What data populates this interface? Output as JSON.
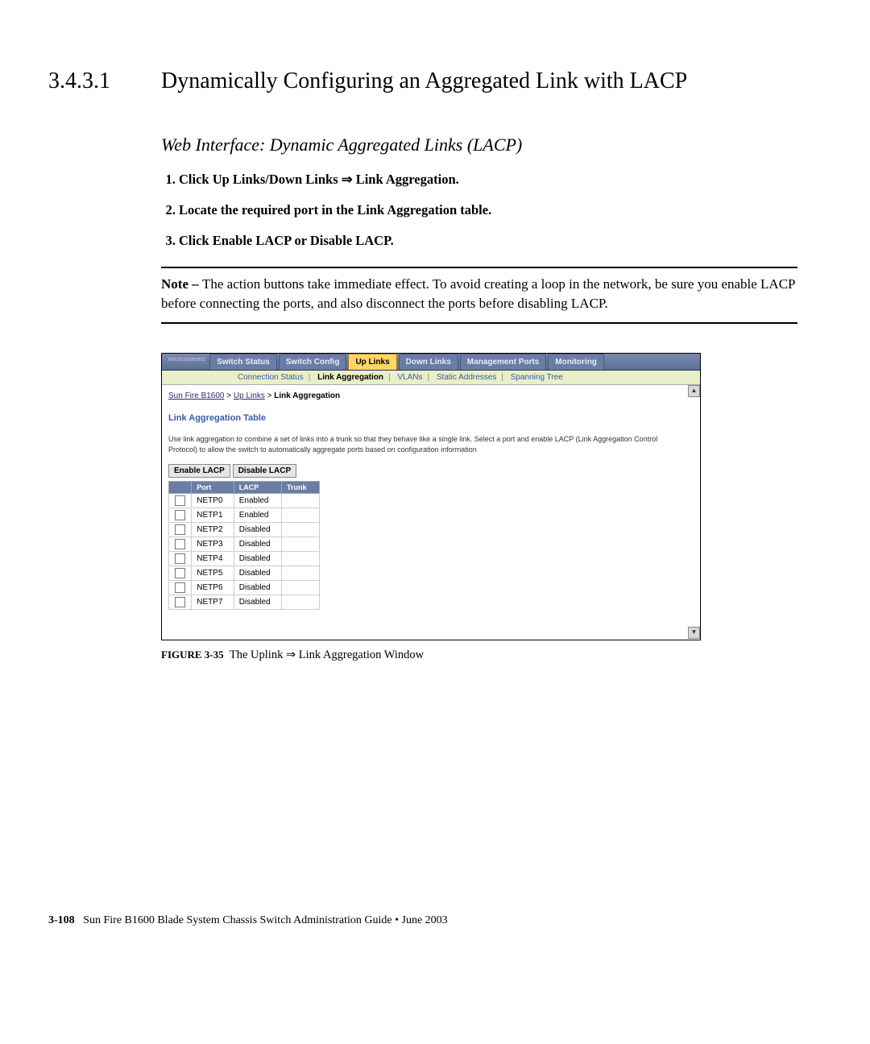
{
  "section_number": "3.4.3.1",
  "section_title": "Dynamically Configuring an Aggregated Link with LACP",
  "subhead": "Web Interface: Dynamic Aggregated Links (LACP)",
  "steps": [
    "Click Up Links/Down Links ⇒ Link Aggregation.",
    "Locate the required port in the Link Aggregation table.",
    "Click Enable LACP or Disable LACP."
  ],
  "note_label": "Note – ",
  "note_body": "The action buttons take immediate effect. To avoid creating a loop in the network, be sure you enable LACP before connecting the ports, and also disconnect the ports before disabling LACP.",
  "caption_label": "FIGURE 3-35",
  "caption_text": "The Uplink ⇒ Link Aggregation Window",
  "footer_page": "3-108",
  "footer_text": "Sun Fire B1600 Blade System Chassis Switch Administration Guide  •  June 2003",
  "ui": {
    "logo": "microsystems",
    "tabs": [
      "Switch Status",
      "Switch Config",
      "Up Links",
      "Down Links",
      "Management Ports",
      "Monitoring"
    ],
    "active_tab": "Up Links",
    "subnav": [
      "Connection Status",
      "Link Aggregation",
      "VLANs",
      "Static Addresses",
      "Spanning Tree"
    ],
    "subnav_active": "Link Aggregation",
    "breadcrumb": {
      "root": "Sun Fire B1600",
      "mid": "Up Links",
      "leaf": "Link Aggregation"
    },
    "table_title": "Link Aggregation Table",
    "description": "Use link aggregation to combine a set of links into a trunk so that they behave like a single link. Select a port and enable LACP (Link Aggregation Control Protocol) to allow the switch to automatically aggregate ports based on configuration information",
    "btn_enable": "Enable LACP",
    "btn_disable": "Disable LACP",
    "columns": [
      "Port",
      "LACP",
      "Trunk"
    ],
    "rows": [
      {
        "port": "NETP0",
        "lacp": "Enabled",
        "trunk": ""
      },
      {
        "port": "NETP1",
        "lacp": "Enabled",
        "trunk": ""
      },
      {
        "port": "NETP2",
        "lacp": "Disabled",
        "trunk": ""
      },
      {
        "port": "NETP3",
        "lacp": "Disabled",
        "trunk": ""
      },
      {
        "port": "NETP4",
        "lacp": "Disabled",
        "trunk": ""
      },
      {
        "port": "NETP5",
        "lacp": "Disabled",
        "trunk": ""
      },
      {
        "port": "NETP6",
        "lacp": "Disabled",
        "trunk": ""
      },
      {
        "port": "NETP7",
        "lacp": "Disabled",
        "trunk": ""
      }
    ]
  }
}
